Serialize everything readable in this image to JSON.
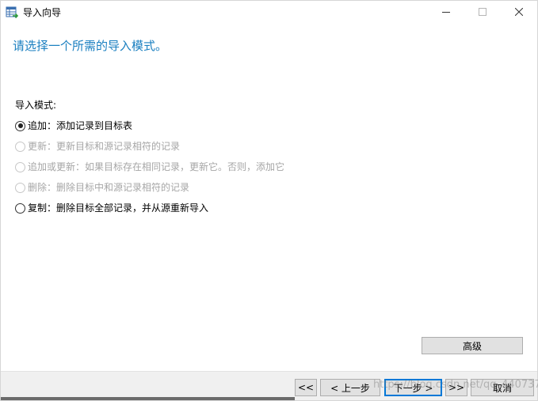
{
  "window": {
    "title": "导入向导",
    "icons": {
      "app": "table-import-icon",
      "minimize": "minimize-icon",
      "maximize": "maximize-icon",
      "close": "close-icon"
    }
  },
  "main": {
    "heading": "请选择一个所需的导入模式。",
    "mode_label": "导入模式:",
    "options": [
      {
        "label": "追加：添加记录到目标表",
        "checked": true,
        "enabled": true
      },
      {
        "label": "更新：更新目标和源记录相符的记录",
        "checked": false,
        "enabled": false
      },
      {
        "label": "追加或更新：如果目标存在相同记录，更新它。否则，添加它",
        "checked": false,
        "enabled": false
      },
      {
        "label": "删除：删除目标中和源记录相符的记录",
        "checked": false,
        "enabled": false
      },
      {
        "label": "复制：删除目标全部记录，并从源重新导入",
        "checked": false,
        "enabled": true
      }
    ],
    "advanced_button": "高级"
  },
  "footer": {
    "first_button": "<<",
    "prev_button": "< 上一步",
    "next_button": "下一步 >",
    "last_button": ">>",
    "cancel_button": "取消"
  },
  "watermark": "https://blog.csdn.net/qq_44073736",
  "colors": {
    "heading": "#1a7fc0",
    "primary_border": "#0078d7",
    "button_face": "#e1e1e1",
    "footer_bg": "#f0f0f0"
  }
}
